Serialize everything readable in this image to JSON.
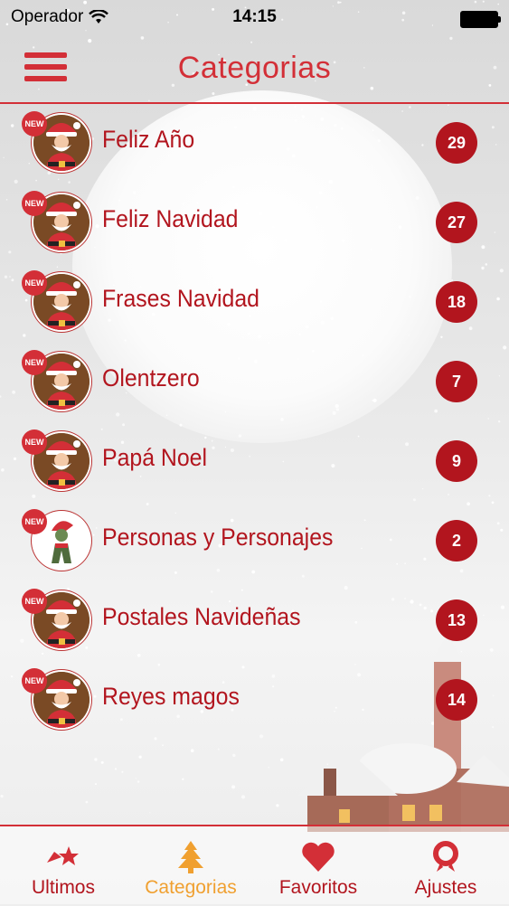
{
  "status_bar": {
    "carrier": "Operador",
    "time": "14:15"
  },
  "header": {
    "title": "Categorias",
    "menu_icon": "hamburger-menu-icon"
  },
  "new_badge": "NEW",
  "categories": [
    {
      "label": "Feliz Año",
      "count": "29",
      "avatar": "santa"
    },
    {
      "label": "Feliz Navidad",
      "count": "27",
      "avatar": "santa"
    },
    {
      "label": "Frases Navidad",
      "count": "18",
      "avatar": "santa"
    },
    {
      "label": "Olentzero",
      "count": "7",
      "avatar": "santa"
    },
    {
      "label": "Papá Noel",
      "count": "9",
      "avatar": "santa"
    },
    {
      "label": "Personas y Personajes",
      "count": "2",
      "avatar": "elf"
    },
    {
      "label": "Postales Navideñas",
      "count": "13",
      "avatar": "santa"
    },
    {
      "label": "Reyes magos",
      "count": "14",
      "avatar": "santa"
    }
  ],
  "tabs": [
    {
      "label": "Ultimos",
      "icon": "shooting-star-icon",
      "active": false
    },
    {
      "label": "Categorias",
      "icon": "christmas-tree-icon",
      "active": true
    },
    {
      "label": "Favoritos",
      "icon": "heart-icon",
      "active": false
    },
    {
      "label": "Ajustes",
      "icon": "wreath-icon",
      "active": false
    }
  ],
  "colors": {
    "accent": "#d32f37",
    "label": "#b2151e",
    "active_tab": "#f0a030"
  }
}
